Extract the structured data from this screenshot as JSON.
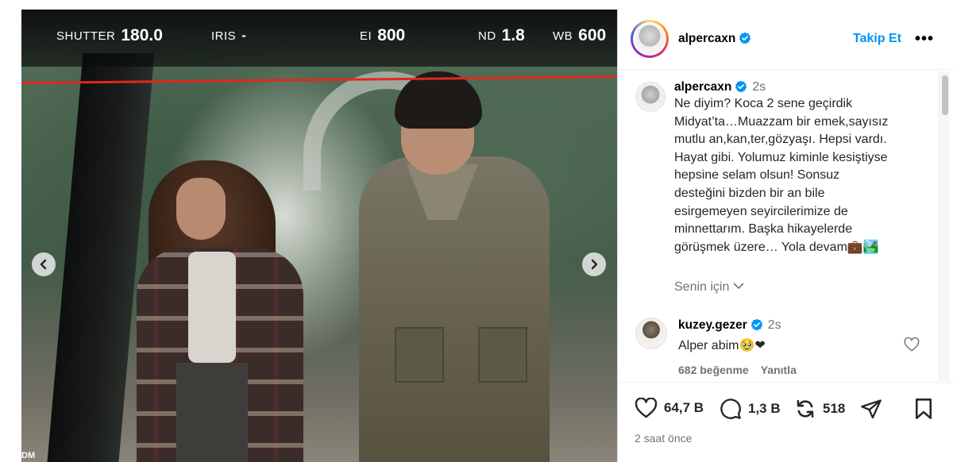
{
  "media": {
    "hud": {
      "shutter_label": "SHUTTER",
      "shutter_value": "180.0",
      "iris_label": "IRIS",
      "iris_value": "-",
      "ei_label": "EI",
      "ei_value": "800",
      "nd_label": "ND",
      "nd_value": "1.8",
      "wb_label": "WB",
      "wb_value": "600"
    },
    "corner_text": "DM",
    "prev_icon": "chevron-left-icon",
    "next_icon": "chevron-right-icon"
  },
  "header": {
    "username": "alpercaxn",
    "follow_label": "Takip Et",
    "more_label": "•••"
  },
  "caption": {
    "username": "alpercaxn",
    "time": "2s",
    "text": "Ne diyim? Koca 2 sene geçirdik\nMidyat’ta…Muazzam bir emek,sayısız\nmutlu an,kan,ter,gözyaşı. Hepsi vardı.\nHayat gibi. Yolumuz kiminle kesiştiyse\nhepsine selam olsun! Sonsuz\ndesteğini bizden bir an bile\nesirgemeyen seyircilerimize de\nminnettarım. Başka hikayelerde\ngörüşmek üzere… Yola devam💼🏞️",
    "translate_label": "Senin için"
  },
  "comment": {
    "username": "kuzey.gezer",
    "time": "2s",
    "text": "Alper abim🥹❤",
    "likes": "682 beğenme",
    "reply_label": "Yanıtla"
  },
  "actions": {
    "likes_count": "64,7 B",
    "comments_count": "1,3 B",
    "reposts_count": "518",
    "date": "2 saat önce"
  },
  "colors": {
    "accent": "#0095f6",
    "verified": "#0095f6",
    "hud_red_line": "#e2281b",
    "muted_text": "#737373"
  }
}
